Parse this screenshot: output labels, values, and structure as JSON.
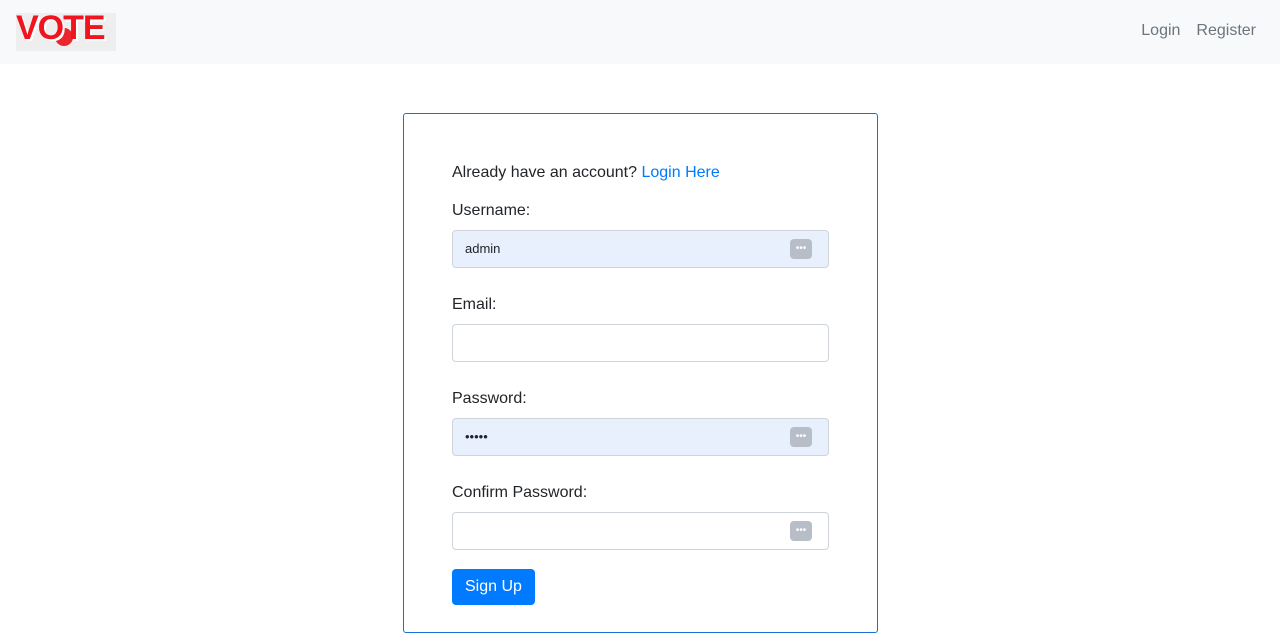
{
  "nav": {
    "logo": "VOTE",
    "links": [
      "Login",
      "Register"
    ]
  },
  "form": {
    "prompt": "Already have an account?",
    "login_link": "Login Here",
    "username_label": "Username:",
    "username_value": "admin",
    "email_label": "Email:",
    "email_value": "",
    "password_label": "Password:",
    "password_value": "•••••",
    "confirm_label": "Confirm Password:",
    "confirm_value": "",
    "submit": "Sign Up"
  }
}
